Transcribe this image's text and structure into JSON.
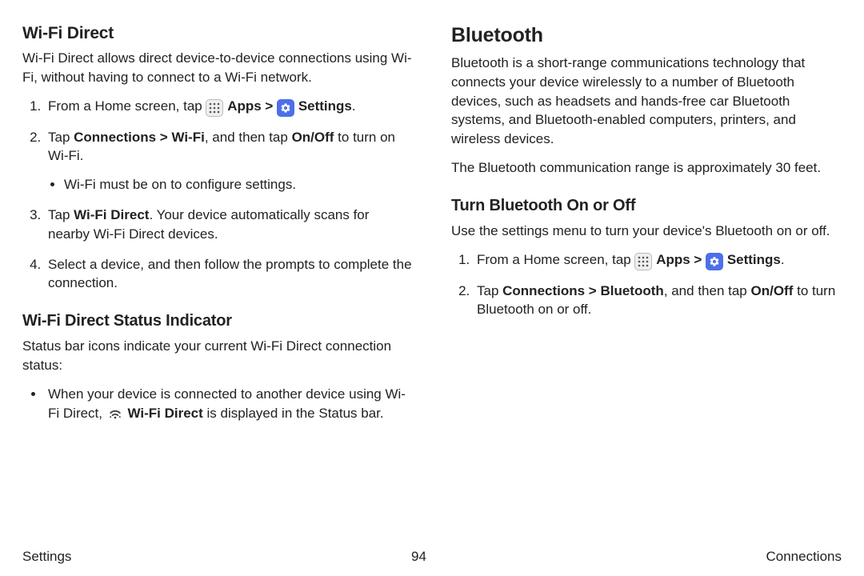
{
  "left": {
    "h1": "Wi-Fi Direct",
    "p1": "Wi-Fi Direct allows direct device-to-device connections using Wi-Fi, without having to connect to a Wi-Fi network.",
    "step1_pre": "From a Home screen, tap ",
    "apps_label": "Apps",
    "sep": " > ",
    "settings_label": "Settings",
    "step1_post": ".",
    "step2_pre": "Tap ",
    "step2_bold": "Connections > Wi-Fi",
    "step2_mid": ", and then tap ",
    "step2_bold2": "On/Off",
    "step2_post": " to turn on Wi-Fi.",
    "step2_sub": "Wi-Fi must be on to configure settings.",
    "step3_pre": "Tap ",
    "step3_bold": "Wi-Fi Direct",
    "step3_post": ". Your device automatically scans for nearby Wi-Fi Direct devices.",
    "step4": "Select a device, and then follow the prompts to complete the connection.",
    "h2": "Wi-Fi Direct Status Indicator",
    "p2": "Status bar icons indicate your current Wi-Fi Direct connection status:",
    "bullet_pre": "When your device is connected to another device using Wi-Fi Direct, ",
    "bullet_bold": "Wi-Fi Direct",
    "bullet_post": " is displayed in the Status bar."
  },
  "right": {
    "h1": "Bluetooth",
    "p1": "Bluetooth is a short-range communications technology that connects your device wirelessly to a number of Bluetooth devices, such as headsets and hands-free car Bluetooth systems, and Bluetooth-enabled computers, printers, and wireless devices.",
    "p2": "The Bluetooth communication range is approximately 30 feet.",
    "h2": "Turn Bluetooth On or Off",
    "p3": "Use the settings menu to turn your device's Bluetooth on or off.",
    "step1_pre": "From a Home screen, tap ",
    "apps_label": "Apps",
    "sep": " > ",
    "settings_label": "Settings",
    "step1_post": ".",
    "step2_pre": "Tap ",
    "step2_bold": "Connections > Bluetooth",
    "step2_mid": ", and then tap ",
    "step2_bold2": "On/Off",
    "step2_post": " to turn Bluetooth on or off."
  },
  "footer": {
    "left": "Settings",
    "center": "94",
    "right": "Connections"
  }
}
